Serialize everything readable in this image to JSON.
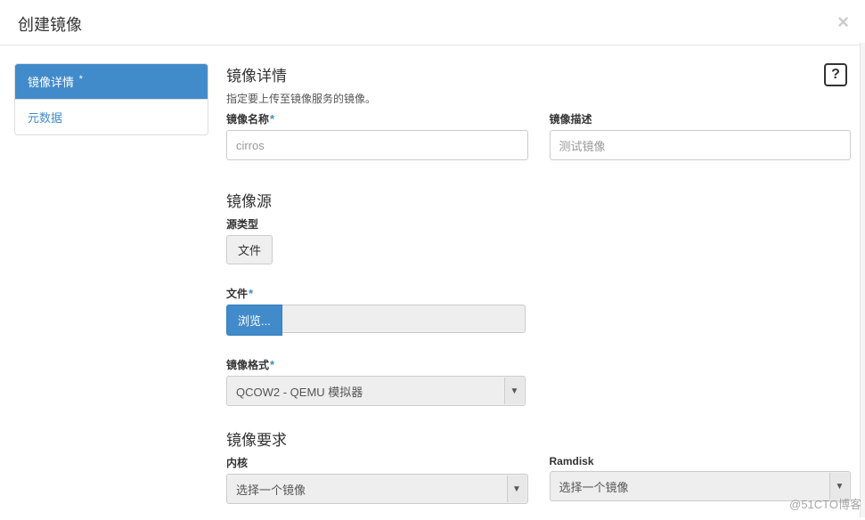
{
  "modal": {
    "title": "创建镜像",
    "close_glyph": "×"
  },
  "sidebar": {
    "items": [
      {
        "label": "镜像详情",
        "required": true,
        "active": true
      },
      {
        "label": "元数据",
        "required": false,
        "active": false
      }
    ],
    "req_mark": "*"
  },
  "help": {
    "glyph": "?"
  },
  "sections": {
    "details": {
      "title": "镜像详情",
      "subtitle": "指定要上传至镜像服务的镜像。",
      "name_label": "镜像名称",
      "name_value": "cirros",
      "desc_label": "镜像描述",
      "desc_value": "测试镜像"
    },
    "source": {
      "title": "镜像源",
      "source_type_label": "源类型",
      "source_type_value": "文件",
      "file_label": "文件",
      "browse_btn": "浏览...",
      "format_label": "镜像格式",
      "format_value": "QCOW2 - QEMU 模拟器"
    },
    "reqs": {
      "title": "镜像要求",
      "kernel_label": "内核",
      "kernel_value": "选择一个镜像",
      "ramdisk_label": "Ramdisk",
      "ramdisk_value": "选择一个镜像"
    }
  },
  "watermark": "@51CTO博客",
  "caret": "▼"
}
